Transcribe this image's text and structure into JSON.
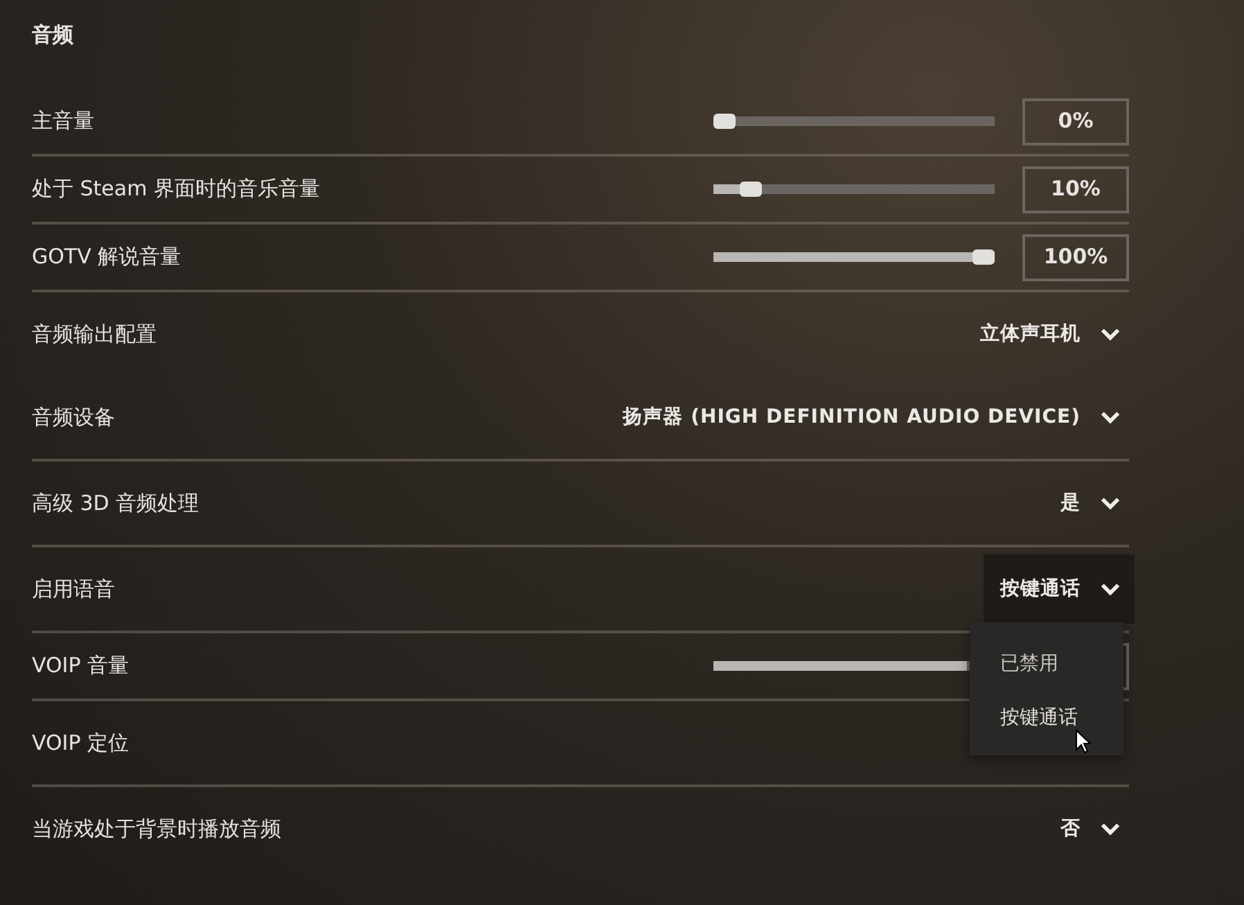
{
  "section_title": "音频",
  "rows": [
    {
      "kind": "slider",
      "label": "主音量",
      "level": 0,
      "reading": "0%",
      "separator": true
    },
    {
      "kind": "slider",
      "label": "处于 Steam 界面时的音乐音量",
      "level": 0.1,
      "reading": "10%",
      "separator": true
    },
    {
      "kind": "slider",
      "label": "GOTV 解说音量",
      "level": 1,
      "reading": "100%",
      "separator": true
    },
    {
      "kind": "dropdown",
      "label": "音频输出配置",
      "value": "立体声耳机",
      "expanded": false,
      "separator": false
    },
    {
      "kind": "dropdown",
      "label": "音频设备",
      "value": "扬声器 (HIGH DEFINITION AUDIO DEVICE)",
      "expanded": false,
      "separator": true
    },
    {
      "kind": "dropdown",
      "label": "高级 3D 音频处理",
      "value": "是",
      "expanded": false,
      "separator": true
    },
    {
      "kind": "dropdown",
      "label": "启用语音",
      "value": "按键通话",
      "expanded": true,
      "separator": true,
      "options": [
        {
          "label": "已禁用",
          "hovered": false
        },
        {
          "label": "按键通话",
          "hovered": true
        }
      ]
    },
    {
      "kind": "slider",
      "label": "VOIP 音量",
      "level": 0.9,
      "separator": true
    },
    {
      "kind": "blank",
      "label": "VOIP 定位",
      "separator": true
    },
    {
      "kind": "dropdown",
      "label": "当游戏处于背景时播放音频",
      "value": "否",
      "expanded": false,
      "separator": false
    }
  ]
}
